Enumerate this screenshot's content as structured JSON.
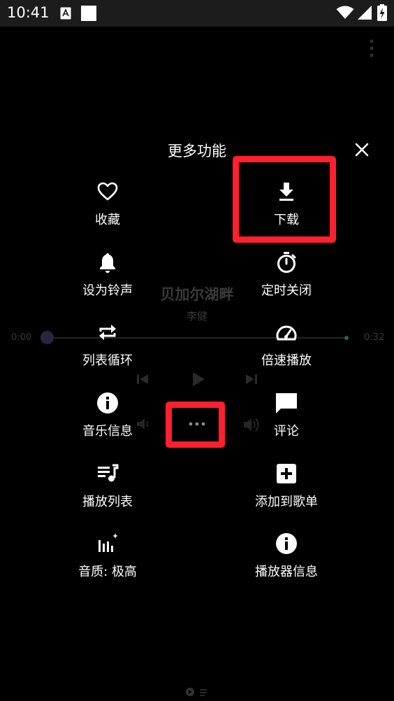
{
  "status_bar": {
    "time": "10:41"
  },
  "background_player": {
    "song_title": "贝加尔湖畔",
    "artist": "李健",
    "time_current": "0:00",
    "time_total": "0:32"
  },
  "sheet": {
    "title": "更多功能",
    "items": [
      {
        "label": "收藏",
        "icon": "heart-outline-icon"
      },
      {
        "label": "下载",
        "icon": "download-icon"
      },
      {
        "label": "设为铃声",
        "icon": "bell-icon"
      },
      {
        "label": "定时关闭",
        "icon": "timer-icon"
      },
      {
        "label": "列表循环",
        "icon": "repeat-icon"
      },
      {
        "label": "倍速播放",
        "icon": "speedometer-icon"
      },
      {
        "label": "音乐信息",
        "icon": "info-icon"
      },
      {
        "label": "评论",
        "icon": "comment-icon"
      },
      {
        "label": "播放列表",
        "icon": "playlist-icon"
      },
      {
        "label": "添加到歌单",
        "icon": "add-box-icon"
      },
      {
        "label": "音质: 极高",
        "icon": "equalizer-icon"
      },
      {
        "label": "播放器信息",
        "icon": "info-icon"
      }
    ]
  },
  "colors": {
    "highlight": "#ff1f2e",
    "background": "#000000",
    "statusbar": "#1c1c1c"
  }
}
